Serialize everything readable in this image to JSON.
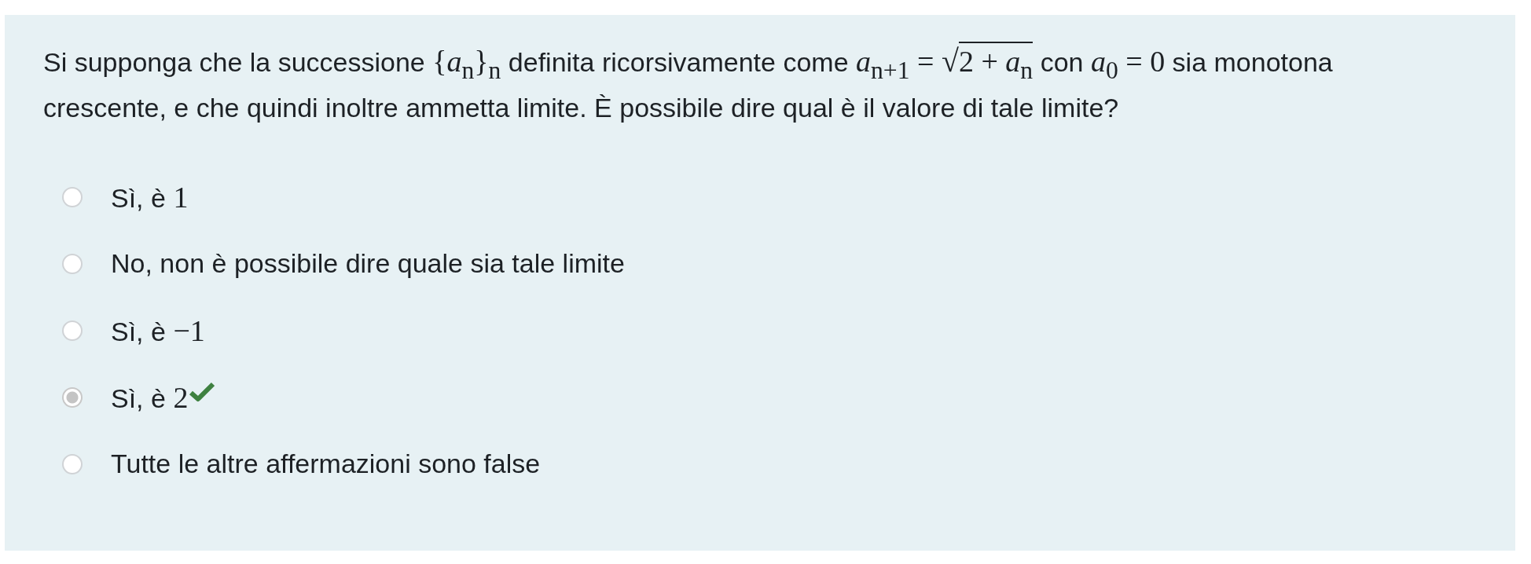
{
  "question": {
    "segments": [
      {
        "kind": "text",
        "text": "Si supponga che la successione "
      },
      {
        "kind": "math",
        "text": "{*a*$_{n}$}$_{n}$"
      },
      {
        "kind": "text",
        "text": " definita ricorsivamente come "
      },
      {
        "kind": "math",
        "text": "*a*$_{n+1}$ = "
      },
      {
        "kind": "sqrt",
        "sign": "√",
        "text": "2 + *a*$_{n}$"
      },
      {
        "kind": "text",
        "text": " con "
      },
      {
        "kind": "math",
        "text": "*a*$_{0}$ = 0"
      },
      {
        "kind": "text",
        "text": " sia monotona crescente, e che quindi inoltre ammetta limite. È  possibile dire qual è il valore di tale limite?"
      }
    ]
  },
  "options": [
    {
      "text": "Sì, è ",
      "math": "1",
      "selected": false,
      "correct": false
    },
    {
      "text": "No, non è possibile dire quale sia tale limite",
      "selected": false,
      "correct": false
    },
    {
      "text": "Sì, è ",
      "math": "−1",
      "selected": false,
      "correct": false
    },
    {
      "text": "Sì, è ",
      "math": "2",
      "selected": true,
      "correct": true
    },
    {
      "text": "Tutte le altre affermazioni sono false",
      "selected": false,
      "correct": false
    }
  ]
}
